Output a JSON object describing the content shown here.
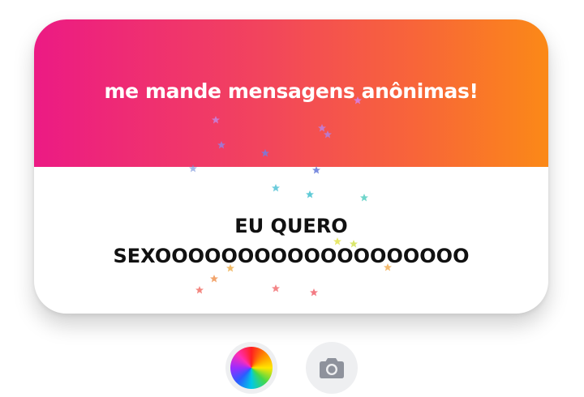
{
  "card": {
    "prompt": "me mande mensagens anônimas!",
    "message": "EU QUERO\nSEXOOOOOOOOOOOOOOOOOOO"
  },
  "controls": {
    "color_button_icon": "color-wheel-icon",
    "camera_button_icon": "camera-icon"
  },
  "colors": {
    "gradient_start": "#ec1a84",
    "gradient_end": "#fb8917",
    "text": "#111111",
    "button_bg": "#eeeff1",
    "camera_icon": "#8e929c"
  },
  "decorations": {
    "sparkle_icon": "star-icon",
    "sparkle_colors": [
      "#c86fd6",
      "#6c7ad8",
      "#46c8d6",
      "#e9e659",
      "#f2a35c",
      "#f07074"
    ]
  }
}
